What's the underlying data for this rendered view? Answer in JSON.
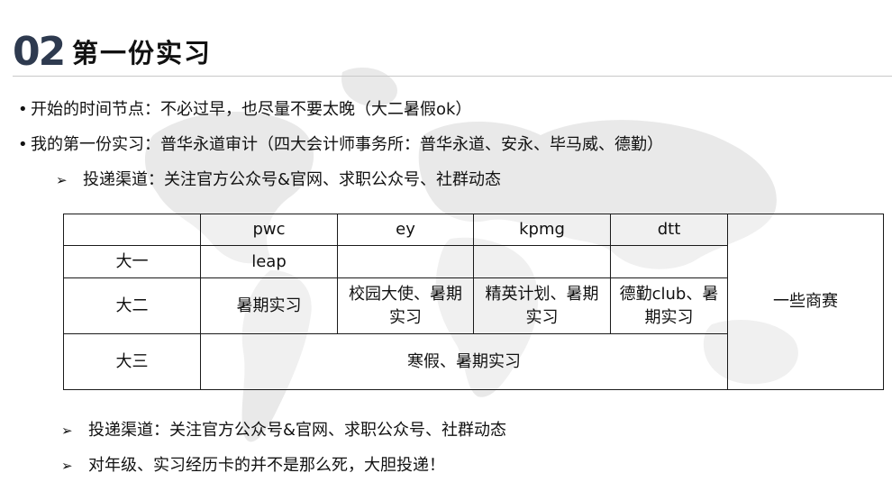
{
  "slide": {
    "number": "02",
    "title": "第一份实习"
  },
  "bullets": [
    "开始的时间节点：不必过早，也尽量不要太晚（大二暑假ok）",
    "我的第一份实习：普华永道审计（四大会计师事务所：普华永道、安永、毕马威、德勤）"
  ],
  "sub_top": "投递渠道：关注官方公众号&官网、求职公众号、社群动态",
  "table": {
    "header": [
      "",
      "pwc",
      "ey",
      "kpmg",
      "dtt"
    ],
    "side_cell": "一些商赛",
    "row1": [
      "大一",
      "leap",
      "",
      "",
      ""
    ],
    "row2": {
      "label": "大二",
      "pwc": "暑期实习",
      "ey": "校园大使、暑期实习",
      "kpmg": "精英计划、暑期实习",
      "dtt": "德勤club、暑期实习"
    },
    "row3": {
      "label": "大三",
      "merged": "寒假、暑期实习"
    }
  },
  "sub_bottom": [
    "投递渠道：关注官方公众号&官网、求职公众号、社群动态",
    "对年级、实习经历卡的并不是那么死，大胆投递！"
  ],
  "icons": {
    "bullet": "•",
    "arrow": "➢"
  },
  "colors": {
    "title_number": "#2e3a4f",
    "map": "#e6e6e6"
  }
}
